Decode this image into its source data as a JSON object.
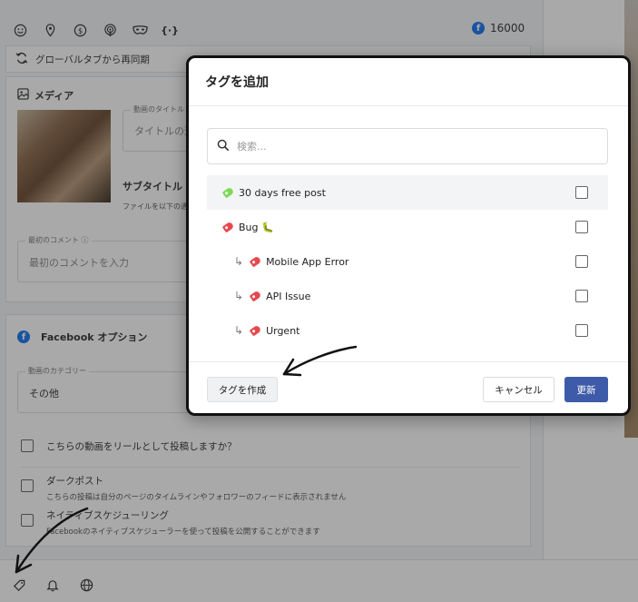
{
  "top_icons": [
    "emoji-icon",
    "location-pin-icon",
    "dollar-icon",
    "podcast-icon",
    "mask-icon",
    "braces-icon"
  ],
  "top_icons_text": {
    "braces": "{·}"
  },
  "fb_count": "16000",
  "resync_label": "グローバルタブから再同期",
  "media": {
    "title": "メディア",
    "video_title_legend": "動画のタイトル",
    "video_title_placeholder": "タイトルの追",
    "subtitle": "サブタイトル",
    "subtitle_note": "ファイルを以下の通",
    "first_comment_legend": "最初のコメント",
    "first_comment_placeholder": "最初のコメントを入力"
  },
  "facebook": {
    "title": "Facebook オプション",
    "category_legend": "動画のカテゴリー",
    "category_value": "その他",
    "reel_label": "こちらの動画をリールとして投稿しますか？",
    "dark_post_label": "ダークポスト",
    "dark_post_desc": "こちらの投稿は自分のページのタイムラインやフォロワーのフィードに表示されません",
    "native_label": "ネイティブスケジューリング",
    "native_desc": "Facebookのネイティブスケジューラーを使って投稿を公開することができます"
  },
  "modal": {
    "title": "タグを追加",
    "search_placeholder": "検索...",
    "tags": [
      {
        "label": "30 days free post",
        "color": "#7ed957",
        "child": false,
        "checked": false
      },
      {
        "label": "Bug 🐛",
        "color": "#e5484d",
        "child": false,
        "checked": false
      },
      {
        "label": "Mobile App Error",
        "color": "#e5484d",
        "child": true,
        "checked": false
      },
      {
        "label": "API Issue",
        "color": "#e5484d",
        "child": true,
        "checked": false
      },
      {
        "label": "Urgent",
        "color": "#e5484d",
        "child": true,
        "checked": false
      }
    ],
    "branch_glyph": "↳",
    "create_label": "タグを作成",
    "cancel_label": "キャンセル",
    "update_label": "更新"
  },
  "bottom_icons": [
    "tag-icon",
    "bell-icon",
    "globe-icon"
  ],
  "colors": {
    "primary": "#3e5ba9",
    "facebook": "#1877f2"
  }
}
